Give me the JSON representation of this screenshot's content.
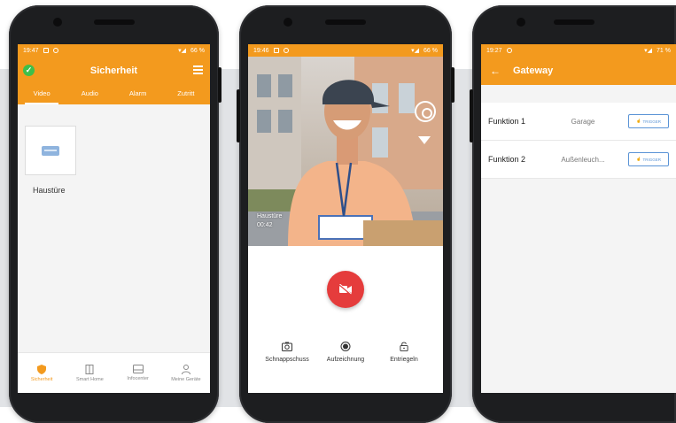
{
  "phone1": {
    "status": {
      "time": "19:47",
      "battery": "66 %"
    },
    "title": "Sicherheit",
    "tabs": [
      "Video",
      "Audio",
      "Alarm",
      "Zutritt"
    ],
    "device_label": "Haustüre",
    "bottom_nav": [
      "Sicherheit",
      "Smart Home",
      "Infocenter",
      "Meine Geräte"
    ]
  },
  "phone2": {
    "status": {
      "time": "19:46",
      "battery": "66 %"
    },
    "overlay": {
      "name": "Haustüre",
      "time": "00:42"
    },
    "actions": [
      "Schnappschuss",
      "Aufzeichnung",
      "Entriegeln"
    ]
  },
  "phone3": {
    "status": {
      "time": "19:27",
      "battery": "71 %"
    },
    "title": "Gateway",
    "rows": [
      {
        "name": "Funktion 1",
        "value": "Garage",
        "button": "TRIGGER"
      },
      {
        "name": "Funktion 2",
        "value": "Außenleuch...",
        "button": "TRIGGER"
      }
    ]
  },
  "colors": {
    "accent": "#f39a1e",
    "record": "#e53c3c",
    "button": "#5b94d6"
  }
}
